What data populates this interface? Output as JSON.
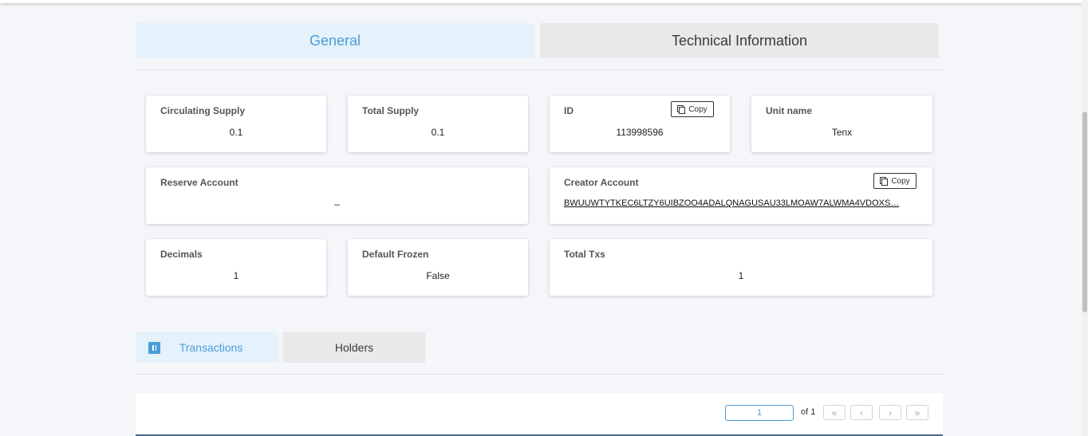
{
  "tabs": {
    "general": "General",
    "technical": "Technical Information"
  },
  "cards": {
    "circulating_supply": {
      "label": "Circulating Supply",
      "value": "0.1"
    },
    "total_supply": {
      "label": "Total Supply",
      "value": "0.1"
    },
    "id": {
      "label": "ID",
      "value": "113998596",
      "copy_label": "Copy"
    },
    "unit_name": {
      "label": "Unit name",
      "value": "Tenx"
    },
    "reserve_account": {
      "label": "Reserve Account",
      "value": "–"
    },
    "creator_account": {
      "label": "Creator Account",
      "value": "BWUUWTYTKEC6LTZY6UIBZOO4ADALQNAGUSAU33LMOAW7ALWMA4VDOXS…",
      "copy_label": "Copy"
    },
    "decimals": {
      "label": "Decimals",
      "value": "1"
    },
    "default_frozen": {
      "label": "Default Frozen",
      "value": "False"
    },
    "total_txs": {
      "label": "Total Txs",
      "value": "1"
    }
  },
  "subtabs": {
    "transactions": "Transactions",
    "holders": "Holders"
  },
  "pagination": {
    "current_page": "1",
    "of_text": "of 1",
    "first": "«",
    "prev": "‹",
    "next": "›",
    "last": "»"
  },
  "icons": {
    "copy": "copy-icon",
    "transactions": "pause-icon"
  },
  "colors": {
    "accent": "#4a9ed8",
    "active_tab_bg": "#e5f1fb",
    "inactive_tab_bg": "#e9e9ea",
    "page_bg": "#f4f6f9"
  }
}
